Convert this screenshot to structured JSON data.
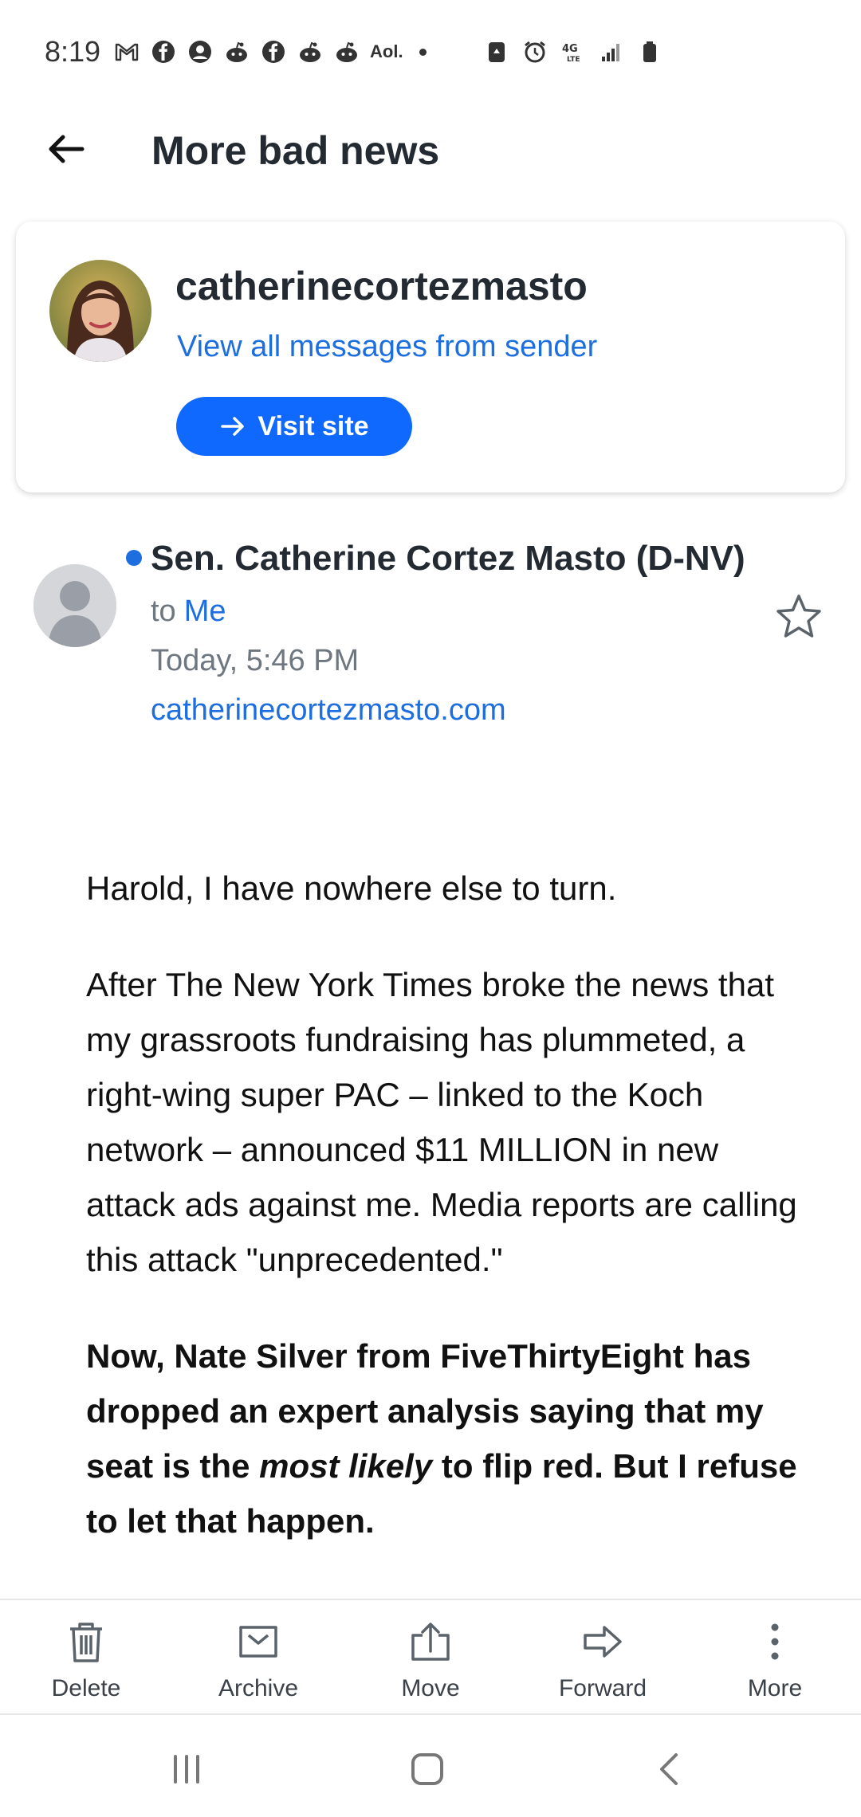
{
  "status_bar": {
    "time": "8:19",
    "aol": "Aol.",
    "icons_left": [
      "gmail-icon",
      "facebook-icon",
      "account-icon",
      "reddit-icon",
      "facebook-icon",
      "reddit-icon",
      "reddit-icon",
      "aol-icon",
      "dot-icon"
    ],
    "icons_right": [
      "recycle-icon",
      "alarm-icon",
      "4g-lte-icon",
      "signal-icon",
      "battery-icon"
    ]
  },
  "header": {
    "title": "More bad news"
  },
  "sender_card": {
    "name": "catherinecortezmasto",
    "view_all_link": "View all messages from sender",
    "visit_button": "Visit site"
  },
  "message": {
    "from": "Sen. Catherine Cortez Masto (D-NV)",
    "to_label": "to",
    "to_value": "Me",
    "date": "Today, 5:46 PM",
    "domain": "catherinecortezmasto.com"
  },
  "body": {
    "p1": "Harold, I have nowhere else to turn.",
    "p2": "After The New York Times broke the news that my grassroots fundraising has plummeted, a right-wing super PAC – linked to the Koch network – announced $11 MILLION in new attack ads against me. Media reports are calling this attack \"unprecedented.\"",
    "p3_before": "Now, Nate Silver from FiveThirtyEight has dropped an expert analysis saying that my seat is the ",
    "p3_em": "most likely",
    "p3_after": " to flip red. But I refuse to let that happen."
  },
  "toolbar": {
    "delete": "Delete",
    "archive": "Archive",
    "move": "Move",
    "forward": "Forward",
    "more": "More"
  },
  "colors": {
    "accent_blue": "#1d6fe0",
    "button_blue": "#0f69ff",
    "text_dark": "#232a31",
    "text_muted": "#6e7780"
  }
}
